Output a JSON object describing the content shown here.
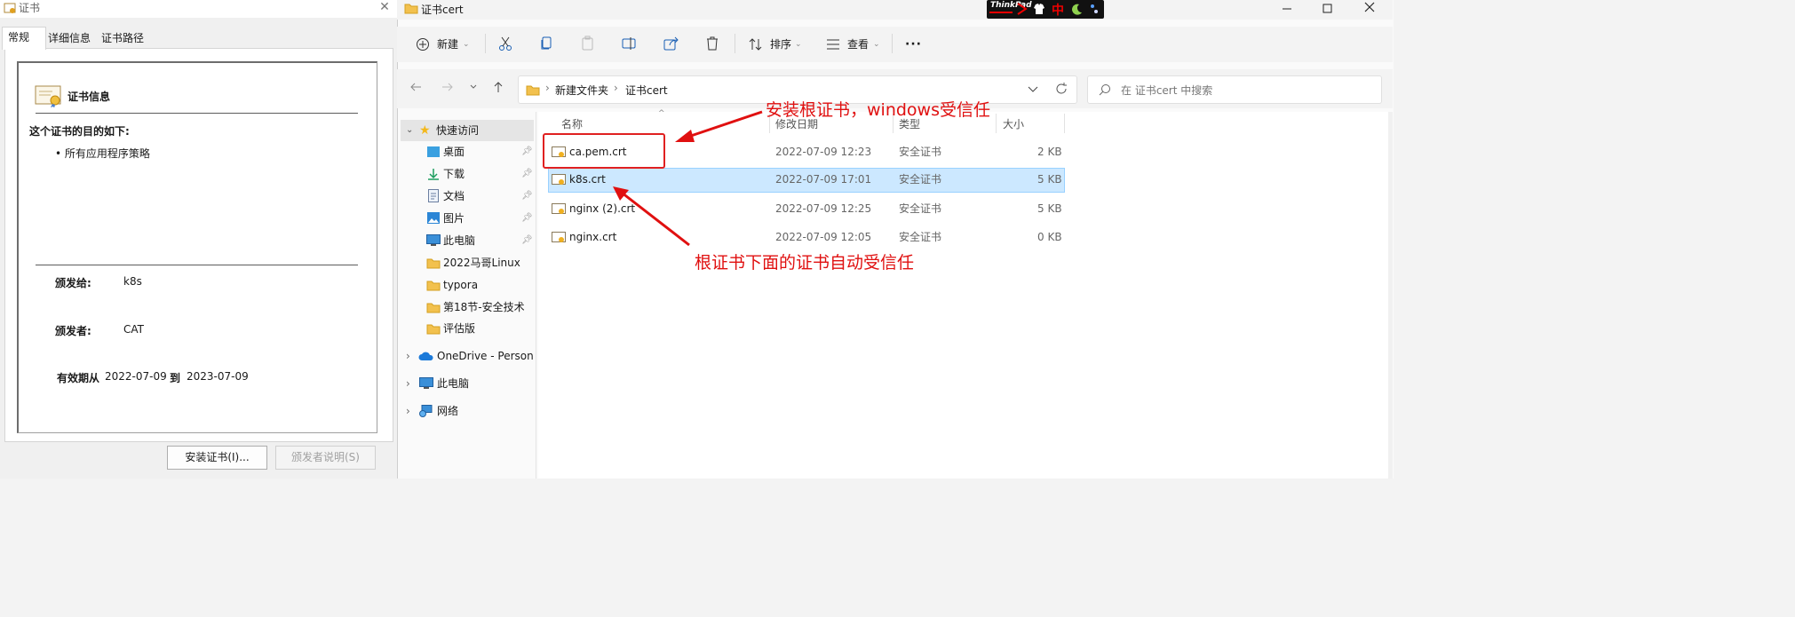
{
  "cert_dialog": {
    "title": "证书",
    "tabs": [
      "常规",
      "详细信息",
      "证书路径"
    ],
    "info_heading": "证书信息",
    "purpose_title": "这个证书的目的如下:",
    "purpose_item": "• 所有应用程序策略",
    "issued_to_label": "颁发给:",
    "issued_to_value": "k8s",
    "issued_by_label": "颁发者:",
    "issued_by_value": "CAT",
    "valid_from_label": "有效期从",
    "valid_from_value": "2022-07-09",
    "valid_to_label": "到",
    "valid_to_value": "2023-07-09",
    "install_button": "安装证书(I)...",
    "issuer_statement_button": "颁发者说明(S)"
  },
  "explorer": {
    "title": "证书cert",
    "tray_label": "ThinkPad",
    "tray_ime": "中",
    "toolbar": {
      "new": "新建",
      "sort": "排序",
      "view": "查看",
      "more": "···"
    },
    "breadcrumb": [
      "新建文件夹",
      "证书cert"
    ],
    "search_placeholder": "在 证书cert 中搜索",
    "nav": {
      "quick_access": "快速访问",
      "items": [
        {
          "label": "桌面",
          "icon": "desktop-icon",
          "pinned": true
        },
        {
          "label": "下载",
          "icon": "download-icon",
          "pinned": true
        },
        {
          "label": "文档",
          "icon": "document-icon",
          "pinned": true
        },
        {
          "label": "图片",
          "icon": "picture-icon",
          "pinned": true
        },
        {
          "label": "此电脑",
          "icon": "computer-icon",
          "pinned": true
        },
        {
          "label": "2022马哥Linux",
          "icon": "folder-icon",
          "pinned": false
        },
        {
          "label": "typora",
          "icon": "folder-icon",
          "pinned": false
        },
        {
          "label": "第18节-安全技术",
          "icon": "folder-icon",
          "pinned": false
        },
        {
          "label": "评估版",
          "icon": "folder-icon",
          "pinned": false
        }
      ],
      "onedrive": "OneDrive - Persona",
      "this_pc": "此电脑",
      "network": "网络"
    },
    "columns": {
      "name": "名称",
      "modified": "修改日期",
      "type": "类型",
      "size": "大小"
    },
    "files": [
      {
        "name": "ca.pem.crt",
        "modified": "2022-07-09 12:23",
        "type": "安全证书",
        "size": "2 KB",
        "selected": false
      },
      {
        "name": "k8s.crt",
        "modified": "2022-07-09 17:01",
        "type": "安全证书",
        "size": "5 KB",
        "selected": true
      },
      {
        "name": "nginx (2).crt",
        "modified": "2022-07-09 12:25",
        "type": "安全证书",
        "size": "5 KB",
        "selected": false
      },
      {
        "name": "nginx.crt",
        "modified": "2022-07-09 12:05",
        "type": "安全证书",
        "size": "0 KB",
        "selected": false
      }
    ]
  },
  "annotations": {
    "top": "安装根证书，windows受信任",
    "bottom": "根证书下面的证书自动受信任",
    "color": "#e01010"
  }
}
